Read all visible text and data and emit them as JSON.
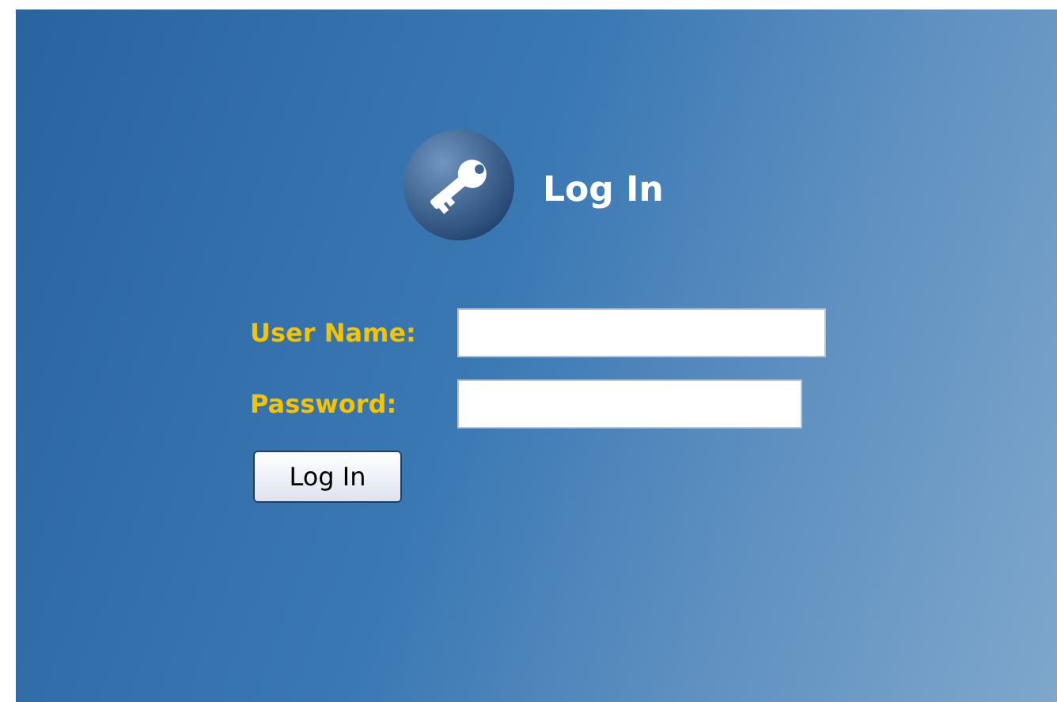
{
  "title": "Log In",
  "fields": [
    {
      "label": "User Name:"
    },
    {
      "label": "Password:"
    }
  ],
  "button": "Log In"
}
